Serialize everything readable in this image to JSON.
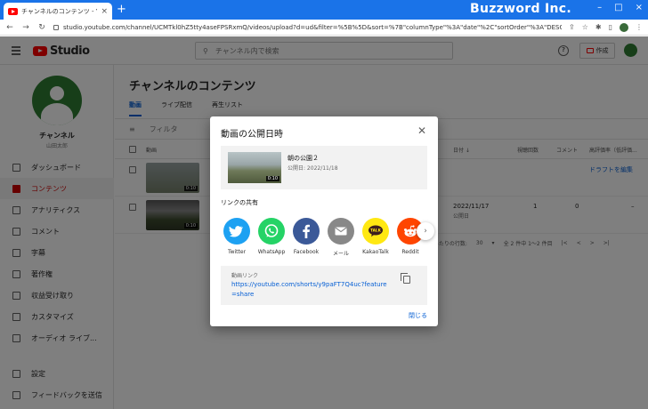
{
  "browser": {
    "tab_title": "チャンネルのコンテンツ - YouTube Studio",
    "url": "studio.youtube.com/channel/UCMTkl0hZ5tty4aseFPSRxmQ/videos/upload?d=ud&filter=%5B%5D&sort=%7B\"columnType\"%3A\"date\"%2C\"sortOrder\"%3A\"DESCENDING\"%7D&...",
    "brand": "Buzzword Inc."
  },
  "header": {
    "logo_text": "Studio",
    "search_placeholder": "チャンネル内で検索",
    "create_label": "作成"
  },
  "sidebar": {
    "channel_name": "チャンネル",
    "channel_owner": "山田太郎",
    "items": [
      {
        "label": "ダッシュボード"
      },
      {
        "label": "コンテンツ"
      },
      {
        "label": "アナリティクス"
      },
      {
        "label": "コメント"
      },
      {
        "label": "字幕"
      },
      {
        "label": "著作権"
      },
      {
        "label": "収益受け取り"
      },
      {
        "label": "カスタマイズ"
      },
      {
        "label": "オーディオ ライブ..."
      }
    ],
    "bottom_items": [
      {
        "label": "設定"
      },
      {
        "label": "フィードバックを送信"
      }
    ]
  },
  "main": {
    "title": "チャンネルのコンテンツ",
    "tabs": [
      {
        "label": "動画"
      },
      {
        "label": "ライブ配信"
      },
      {
        "label": "再生リスト"
      }
    ],
    "filter_label": "フィルタ",
    "columns": {
      "video": "動画",
      "date": "日付 ↓",
      "views": "視聴回数",
      "comments": "コメント",
      "likes": "高評価率（低評価..."
    },
    "rows": [
      {
        "duration": "0:10",
        "action": "ドラフトを編集",
        "date": "",
        "date_sub": "",
        "views": "",
        "comments": ""
      },
      {
        "duration": "0:10",
        "action": "",
        "date": "2022/11/17",
        "date_sub": "公開日",
        "views": "1",
        "comments": "0",
        "likes": "–"
      }
    ],
    "pager": {
      "rows_label": "ページあたりの行数:",
      "rows_value": "30",
      "range": "全 2 件中 1～2 件目"
    }
  },
  "modal": {
    "title": "動画の公開日時",
    "video_title": "朝の公園２",
    "video_date": "公開日: 2022/11/18",
    "video_duration": "0:10",
    "share_heading": "リンクの共有",
    "share_targets": [
      {
        "label": "Twitter",
        "color": "#1da1f2",
        "icon": "twitter-bird-icon"
      },
      {
        "label": "WhatsApp",
        "color": "#25d366",
        "icon": "whatsapp-icon"
      },
      {
        "label": "Facebook",
        "color": "#3b5998",
        "icon": "facebook-icon"
      },
      {
        "label": "メール",
        "color": "#888888",
        "icon": "mail-icon"
      },
      {
        "label": "KakaoTalk",
        "color": "#ffe812",
        "icon": "kakaotalk-icon"
      },
      {
        "label": "Reddit",
        "color": "#ff4500",
        "icon": "reddit-icon"
      }
    ],
    "link_label": "動画リンク",
    "link_url": "https://youtube.com/shorts/y9paFT7Q4uc?feature=share",
    "done_label": "閉じる"
  }
}
